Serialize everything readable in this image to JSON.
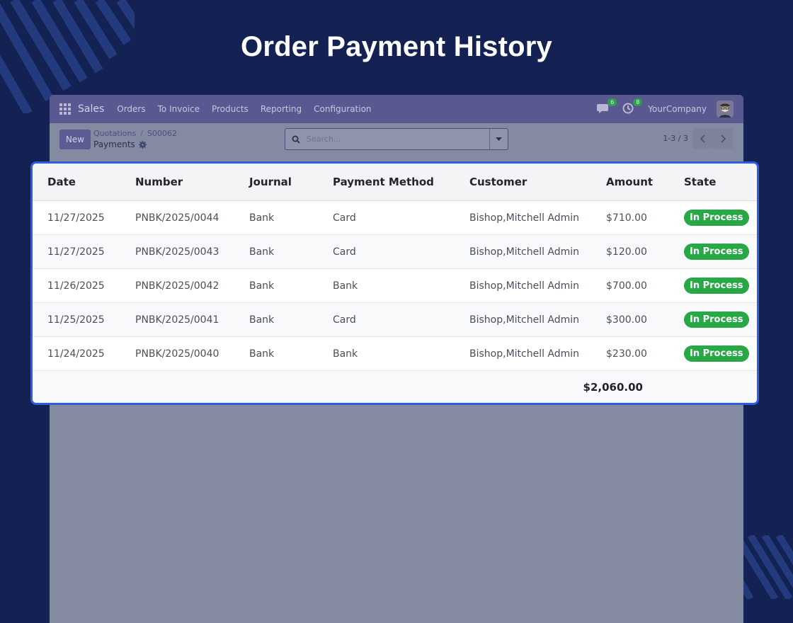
{
  "page_title": "Order Payment History",
  "colors": {
    "background": "#132153",
    "accent_border": "#2b5ee6",
    "status_green": "#28a745",
    "navbar": "#5a5891"
  },
  "navbar": {
    "brand": "Sales",
    "items": [
      "Orders",
      "To Invoice",
      "Products",
      "Reporting",
      "Configuration"
    ],
    "messages_badge": "6",
    "activities_badge": "8",
    "company": "YourCompany"
  },
  "control": {
    "new_label": "New",
    "breadcrumb": [
      "Quotations",
      "S00062"
    ],
    "current": "Payments",
    "search_placeholder": "Search...",
    "pager": "1-3 / 3"
  },
  "table": {
    "headers": {
      "date": "Date",
      "number": "Number",
      "journal": "Journal",
      "payment_method": "Payment Method",
      "customer": "Customer",
      "amount": "Amount",
      "state": "State"
    },
    "rows": [
      {
        "date": "11/27/2025",
        "number": "PNBK/2025/0044",
        "journal": "Bank",
        "payment_method": "Card",
        "customer": "Bishop,Mitchell Admin",
        "amount": "$710.00",
        "state": "In Process"
      },
      {
        "date": "11/27/2025",
        "number": "PNBK/2025/0043",
        "journal": "Bank",
        "payment_method": "Card",
        "customer": "Bishop,Mitchell Admin",
        "amount": "$120.00",
        "state": "In Process"
      },
      {
        "date": "11/26/2025",
        "number": "PNBK/2025/0042",
        "journal": "Bank",
        "payment_method": "Bank",
        "customer": "Bishop,Mitchell Admin",
        "amount": "$700.00",
        "state": "In Process"
      },
      {
        "date": "11/25/2025",
        "number": "PNBK/2025/0041",
        "journal": "Bank",
        "payment_method": "Card",
        "customer": "Bishop,Mitchell Admin",
        "amount": "$300.00",
        "state": "In Process"
      },
      {
        "date": "11/24/2025",
        "number": "PNBK/2025/0040",
        "journal": "Bank",
        "payment_method": "Bank",
        "customer": "Bishop,Mitchell Admin",
        "amount": "$230.00",
        "state": "In Process"
      }
    ],
    "total": "$2,060.00"
  }
}
